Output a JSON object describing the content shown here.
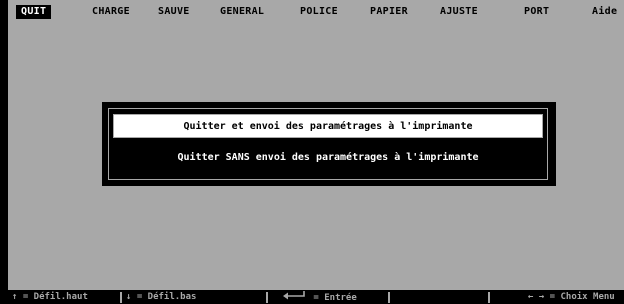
{
  "menu": {
    "items": [
      {
        "label": "QUIT",
        "active": true
      },
      {
        "label": "CHARGE"
      },
      {
        "label": "SAUVE"
      },
      {
        "label": "GENERAL"
      },
      {
        "label": "POLICE"
      },
      {
        "label": "PAPIER"
      },
      {
        "label": "AJUSTE"
      },
      {
        "label": "PORT"
      },
      {
        "label": "Aide"
      }
    ]
  },
  "dialog": {
    "options": [
      {
        "label": "Quitter et envoi des paramétrages à l'imprimante",
        "selected": true
      },
      {
        "label": "Quitter SANS envoi des paramétrages à l'imprimante",
        "selected": false
      }
    ]
  },
  "statusbar": {
    "scroll_up": "↑ = Défil.haut",
    "scroll_down": "↓ = Défil.bas",
    "enter_icon": "enter-arrow-icon",
    "enter": "= Entrée",
    "menu_choice": "← → = Choix Menu"
  },
  "colors": {
    "background": "#a8a8a8",
    "selected_bg": "#ffffff",
    "dialog_bg": "#000000",
    "status_text": "#a8a8a8"
  }
}
